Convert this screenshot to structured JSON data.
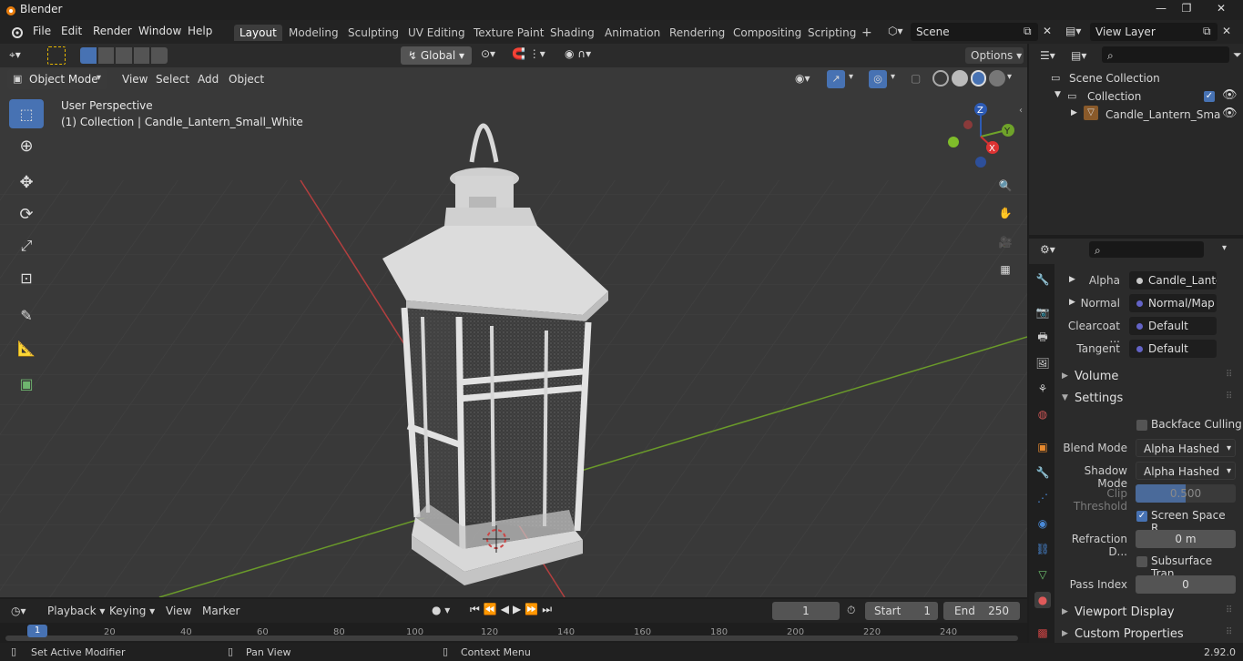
{
  "window": {
    "title": "Blender",
    "min": "—",
    "max": "❐",
    "close": "✕"
  },
  "menus": [
    "File",
    "Edit",
    "Render",
    "Window",
    "Help"
  ],
  "workspaces": [
    "Layout",
    "Modeling",
    "Sculpting",
    "UV Editing",
    "Texture Paint",
    "Shading",
    "Animation",
    "Rendering",
    "Compositing",
    "Scripting"
  ],
  "active_workspace": "Layout",
  "add_workspace": "+",
  "scene": {
    "name": "Scene",
    "view_layer": "View Layer"
  },
  "toolheader": {
    "orientation": "Global",
    "options": "Options"
  },
  "viewport_header": {
    "mode": "Object Mode",
    "view": "View",
    "select": "Select",
    "add": "Add",
    "object": "Object"
  },
  "viewport": {
    "perspective": "User Perspective",
    "collection_info": "(1) Collection | Candle_Lantern_Small_White"
  },
  "gizmo": {
    "z": "Z",
    "y": "Y",
    "x": "X"
  },
  "outliner": {
    "scene_collection": "Scene Collection",
    "collection": "Collection",
    "object": "Candle_Lantern_Sma"
  },
  "properties": {
    "rows": [
      {
        "label": "Alpha",
        "value": "Candle_Lante..."
      },
      {
        "label": "Normal",
        "value": "Normal/Map"
      },
      {
        "label": "Clearcoat ...",
        "value": "Default"
      },
      {
        "label": "Tangent",
        "value": "Default"
      }
    ],
    "volume": "Volume",
    "settings": "Settings",
    "backface_culling": "Backface Culling",
    "blend_mode_label": "Blend Mode",
    "blend_mode": "Alpha Hashed",
    "shadow_mode_label": "Shadow Mode",
    "shadow_mode": "Alpha Hashed",
    "clip_threshold_label": "Clip Threshold",
    "clip_threshold": "0.500",
    "screen_space": "Screen Space R...",
    "refraction_label": "Refraction D...",
    "refraction": "0 m",
    "subsurface": "Subsurface Tran...",
    "pass_index_label": "Pass Index",
    "pass_index": "0",
    "viewport_display": "Viewport Display",
    "custom_properties": "Custom Properties"
  },
  "timeline": {
    "playback": "Playback",
    "keying": "Keying",
    "view": "View",
    "marker": "Marker",
    "current_frame": "1",
    "start_label": "Start",
    "start": "1",
    "end_label": "End",
    "end": "250",
    "ticks": [
      "1",
      "20",
      "40",
      "60",
      "80",
      "100",
      "120",
      "140",
      "160",
      "180",
      "200",
      "220",
      "240"
    ]
  },
  "status": {
    "left": "Set Active Modifier",
    "mid": "Pan View",
    "right": "Context Menu",
    "version": "2.92.0"
  }
}
